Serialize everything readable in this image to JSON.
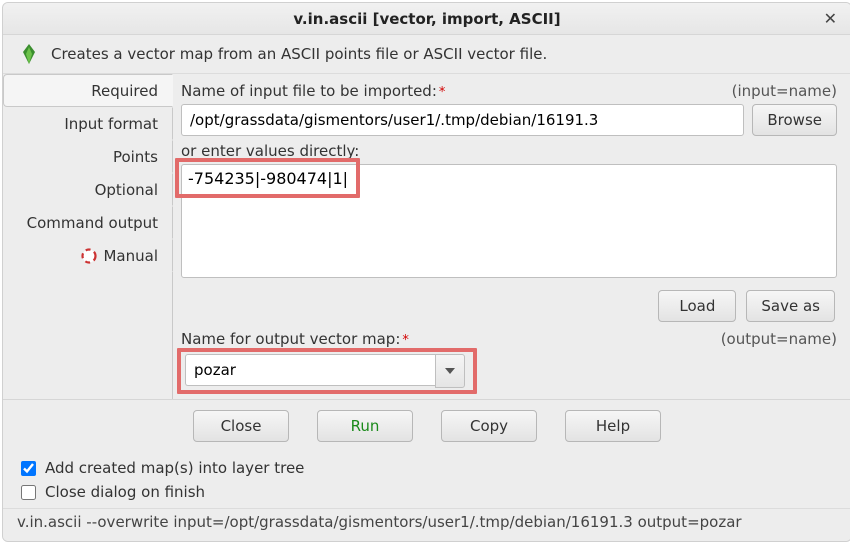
{
  "window": {
    "title": "v.in.ascii [vector, import, ASCII]"
  },
  "description": "Creates a vector map from an ASCII points file or ASCII vector file.",
  "tabs": {
    "required": "Required",
    "input_format": "Input format",
    "points": "Points",
    "optional": "Optional",
    "command_output": "Command output",
    "manual": "Manual"
  },
  "fields": {
    "input_label": "Name of input file to be imported:",
    "input_hint": "(input=name)",
    "input_value": "/opt/grassdata/gismentors/user1/.tmp/debian/16191.3",
    "browse": "Browse",
    "direct_label": "or enter values directly:",
    "direct_value": "-754235|-980474|1|",
    "load": "Load",
    "saveas": "Save as",
    "output_label": "Name for output vector map:",
    "output_hint": "(output=name)",
    "output_value": "pozar"
  },
  "buttons": {
    "close": "Close",
    "run": "Run",
    "copy": "Copy",
    "help": "Help"
  },
  "checks": {
    "add_layer": "Add created map(s) into layer tree",
    "close_dialog": "Close dialog on finish"
  },
  "command": "v.in.ascii --overwrite input=/opt/grassdata/gismentors/user1/.tmp/debian/16191.3 output=pozar"
}
